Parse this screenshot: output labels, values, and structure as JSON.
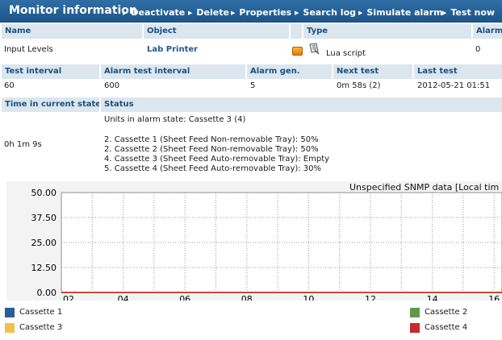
{
  "titlebar": {
    "title": "Monitor information",
    "actions": [
      "Deactivate",
      "Delete",
      "Properties",
      "Search log",
      "Simulate alarm",
      "Test now"
    ]
  },
  "row1": {
    "headers": [
      "Name",
      "Object",
      "Type",
      "Alarm"
    ],
    "name": "Input Levels",
    "object": "Lab Printer",
    "type": "Lua script",
    "alarm": "0"
  },
  "row2": {
    "headers": [
      "Test interval",
      "Alarm test interval",
      "Alarm gen.",
      "Next test",
      "Last test"
    ],
    "test_interval": "60",
    "alarm_test_interval": "600",
    "alarm_gen": "5",
    "next_test": "0m 58s (2)",
    "last_test": "2012-05-21 01:51"
  },
  "row3": {
    "headers": [
      "Time in current state",
      "Status"
    ],
    "time_in_state": "0h 1m 9s",
    "status_lines": [
      "Units in alarm state: Cassette 3 (4)",
      "2. Cassette 1 (Sheet Feed Non-removable Tray): 50%",
      "2. Cassette 2 (Sheet Feed Non-removable Tray): 50%",
      "4. Cassette 3 (Sheet Feed Auto-removable Tray): Empty",
      "5. Cassette 4 (Sheet Feed Auto-removable Tray): 30%"
    ]
  },
  "chart_data": {
    "type": "line",
    "title": "Unspecified SNMP data [Local tim",
    "x_ticks": [
      "02",
      "04",
      "06",
      "08",
      "10",
      "12",
      "14",
      "16"
    ],
    "y_ticks": [
      "0.00",
      "12.50",
      "25.00",
      "37.50",
      "50.00"
    ],
    "ylim": [
      0,
      50
    ],
    "grid": true,
    "series": [
      {
        "name": "Cassette 1",
        "color": "#2a5d9a",
        "values": [
          0,
          0,
          0,
          0,
          0,
          0,
          0,
          0
        ]
      },
      {
        "name": "Cassette 2",
        "color": "#5f9a4a",
        "values": [
          0,
          0,
          0,
          0,
          0,
          0,
          0,
          0
        ]
      },
      {
        "name": "Cassette 3",
        "color": "#f4c04a",
        "values": [
          0,
          0,
          0,
          0,
          0,
          0,
          0,
          0
        ]
      },
      {
        "name": "Cassette 4",
        "color": "#c62a2a",
        "values": [
          0,
          0,
          0,
          0,
          0,
          0,
          0,
          0
        ]
      }
    ]
  },
  "colors": {
    "accent": "#1f5a8d",
    "header_bg": "#dbe6ef"
  }
}
